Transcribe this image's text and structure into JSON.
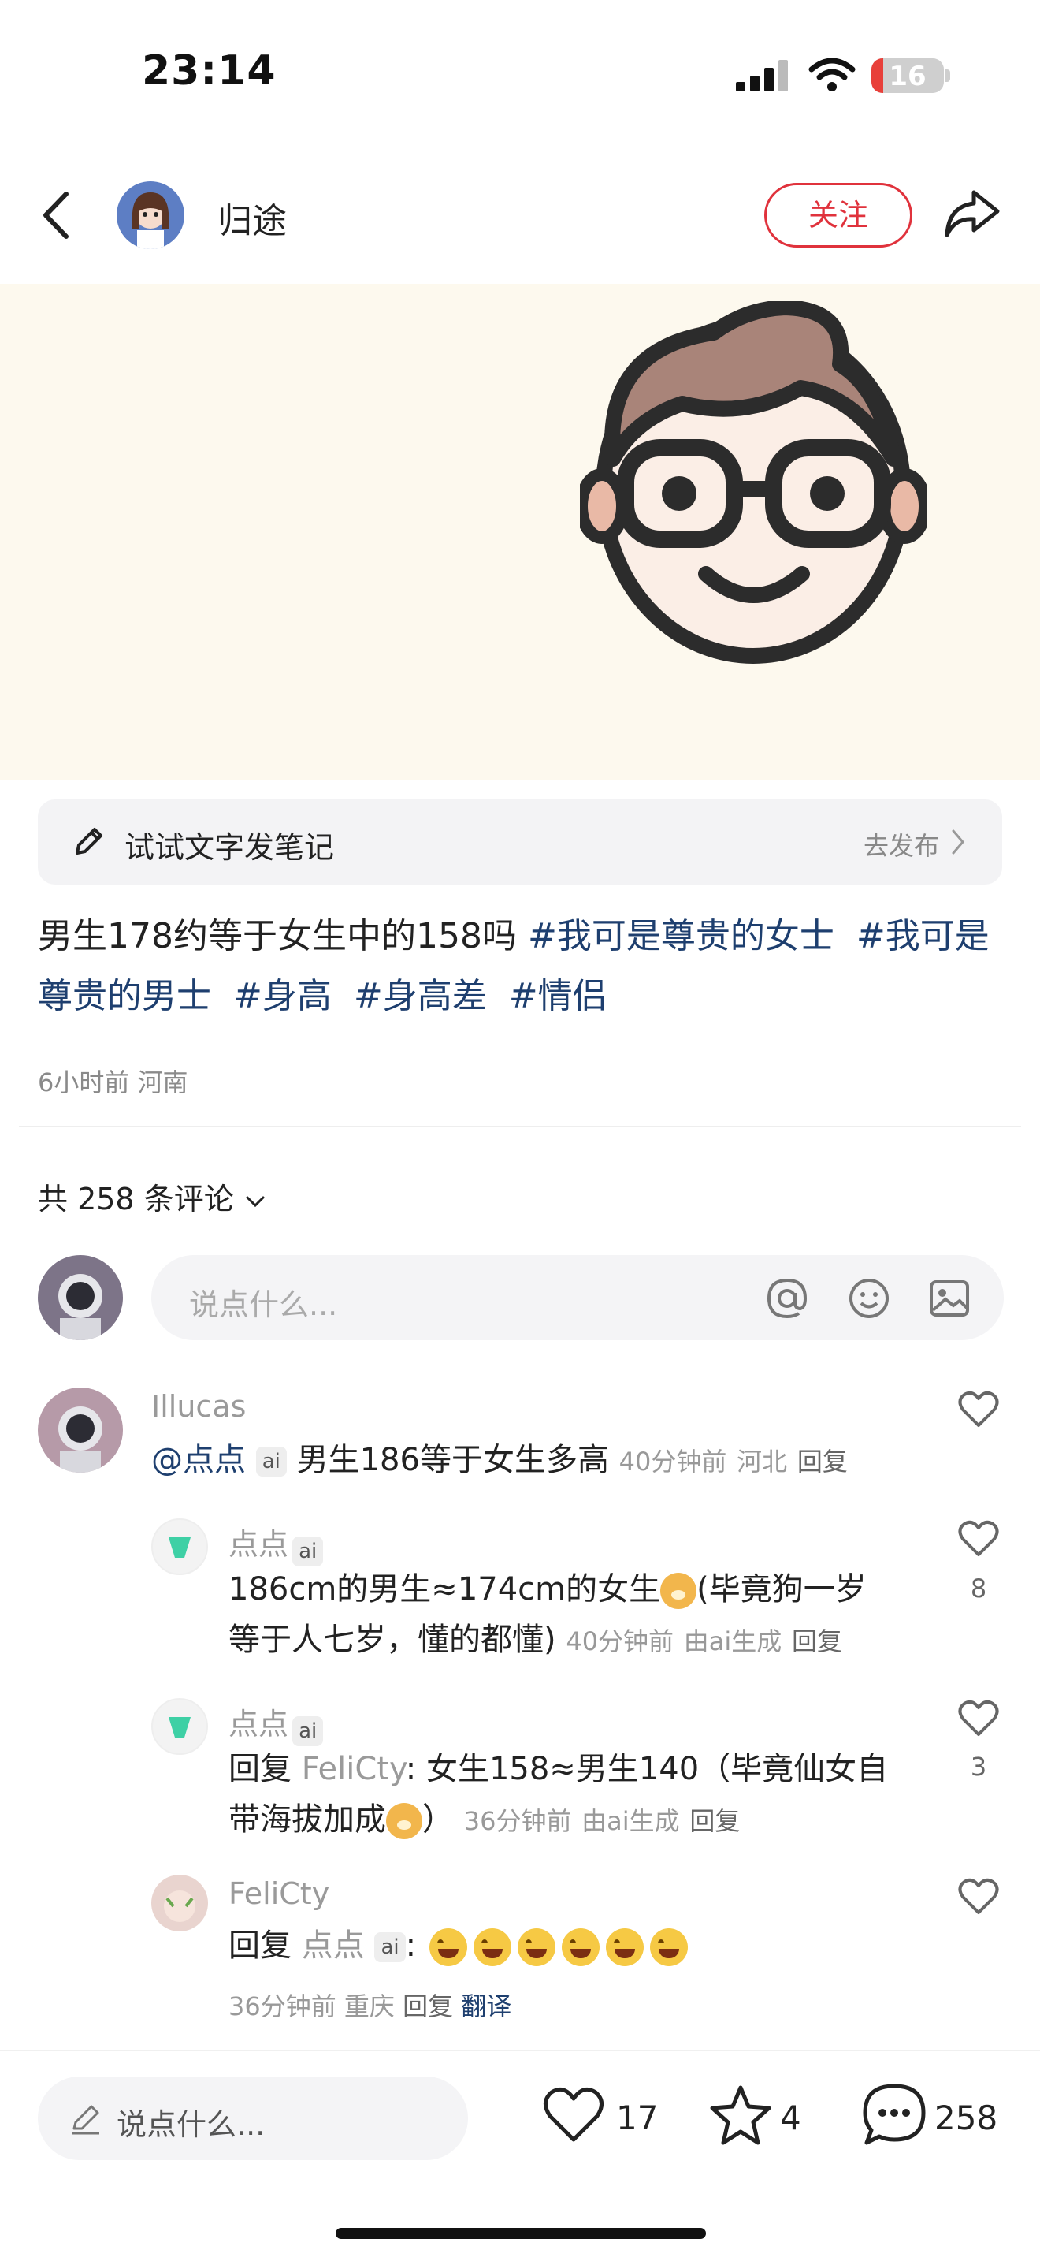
{
  "status_bar": {
    "time": "23:14",
    "battery": "16",
    "battery_fraction": 0.16
  },
  "header": {
    "author": "归途",
    "follow_label": "关注"
  },
  "note_bar": {
    "label": "试试文字发笔记",
    "action": "去发布"
  },
  "post": {
    "text": "男生178约等于女生中的158吗",
    "tags": [
      "#我可是尊贵的女士",
      "#我可是尊贵的男士",
      "#身高",
      "#身高差",
      "#情侣"
    ],
    "time": "6小时前",
    "location": "河南"
  },
  "comments_header": {
    "count_label": "共 258 条评论"
  },
  "comment_input": {
    "placeholder": "说点什么..."
  },
  "comments": [
    {
      "user": "Illucas",
      "mention": "@点点",
      "ai_badge": "ai",
      "text": "男生186等于女生多高",
      "time": "40分钟前",
      "location": "河北",
      "reply": "回复",
      "likes": ""
    },
    {
      "user": "点点",
      "ai_badge": "ai",
      "text_line1": "186cm的男生≈174cm的女生",
      "text_line1b": "(毕竟狗一岁",
      "text_line2": "等于人七岁，懂的都懂)",
      "time": "40分钟前",
      "gen": "由ai生成",
      "reply": "回复",
      "likes": "8"
    },
    {
      "user": "点点",
      "ai_badge": "ai",
      "reply_prefix": "回复",
      "reply_to": "FeliCty",
      "text_line1": ": 女生158≈男生140（毕竟仙女自",
      "text_line2": "带海拔加成",
      "text_line2b": "）",
      "time": "36分钟前",
      "gen": "由ai生成",
      "reply": "回复",
      "likes": "3"
    },
    {
      "user": "FeliCty",
      "reply_prefix": "回复",
      "reply_to": "点点",
      "ai_badge": "ai",
      "colon": ":",
      "time": "36分钟前",
      "location": "重庆",
      "reply": "回复",
      "translate": "翻译",
      "likes": ""
    }
  ],
  "bottom_bar": {
    "placeholder": "说点什么...",
    "likes": "17",
    "favorites": "4",
    "comments": "258"
  },
  "icons": [
    "back-icon",
    "share-icon",
    "pencil-icon",
    "chevron-right-icon",
    "chevron-down-icon",
    "at-icon",
    "emoji-icon",
    "image-icon",
    "heart-icon",
    "star-icon",
    "comment-icon"
  ],
  "colors": {
    "accent": "#e0323c",
    "hashtag": "#1e3f6f",
    "hero_bg": "#fdf9ee"
  }
}
